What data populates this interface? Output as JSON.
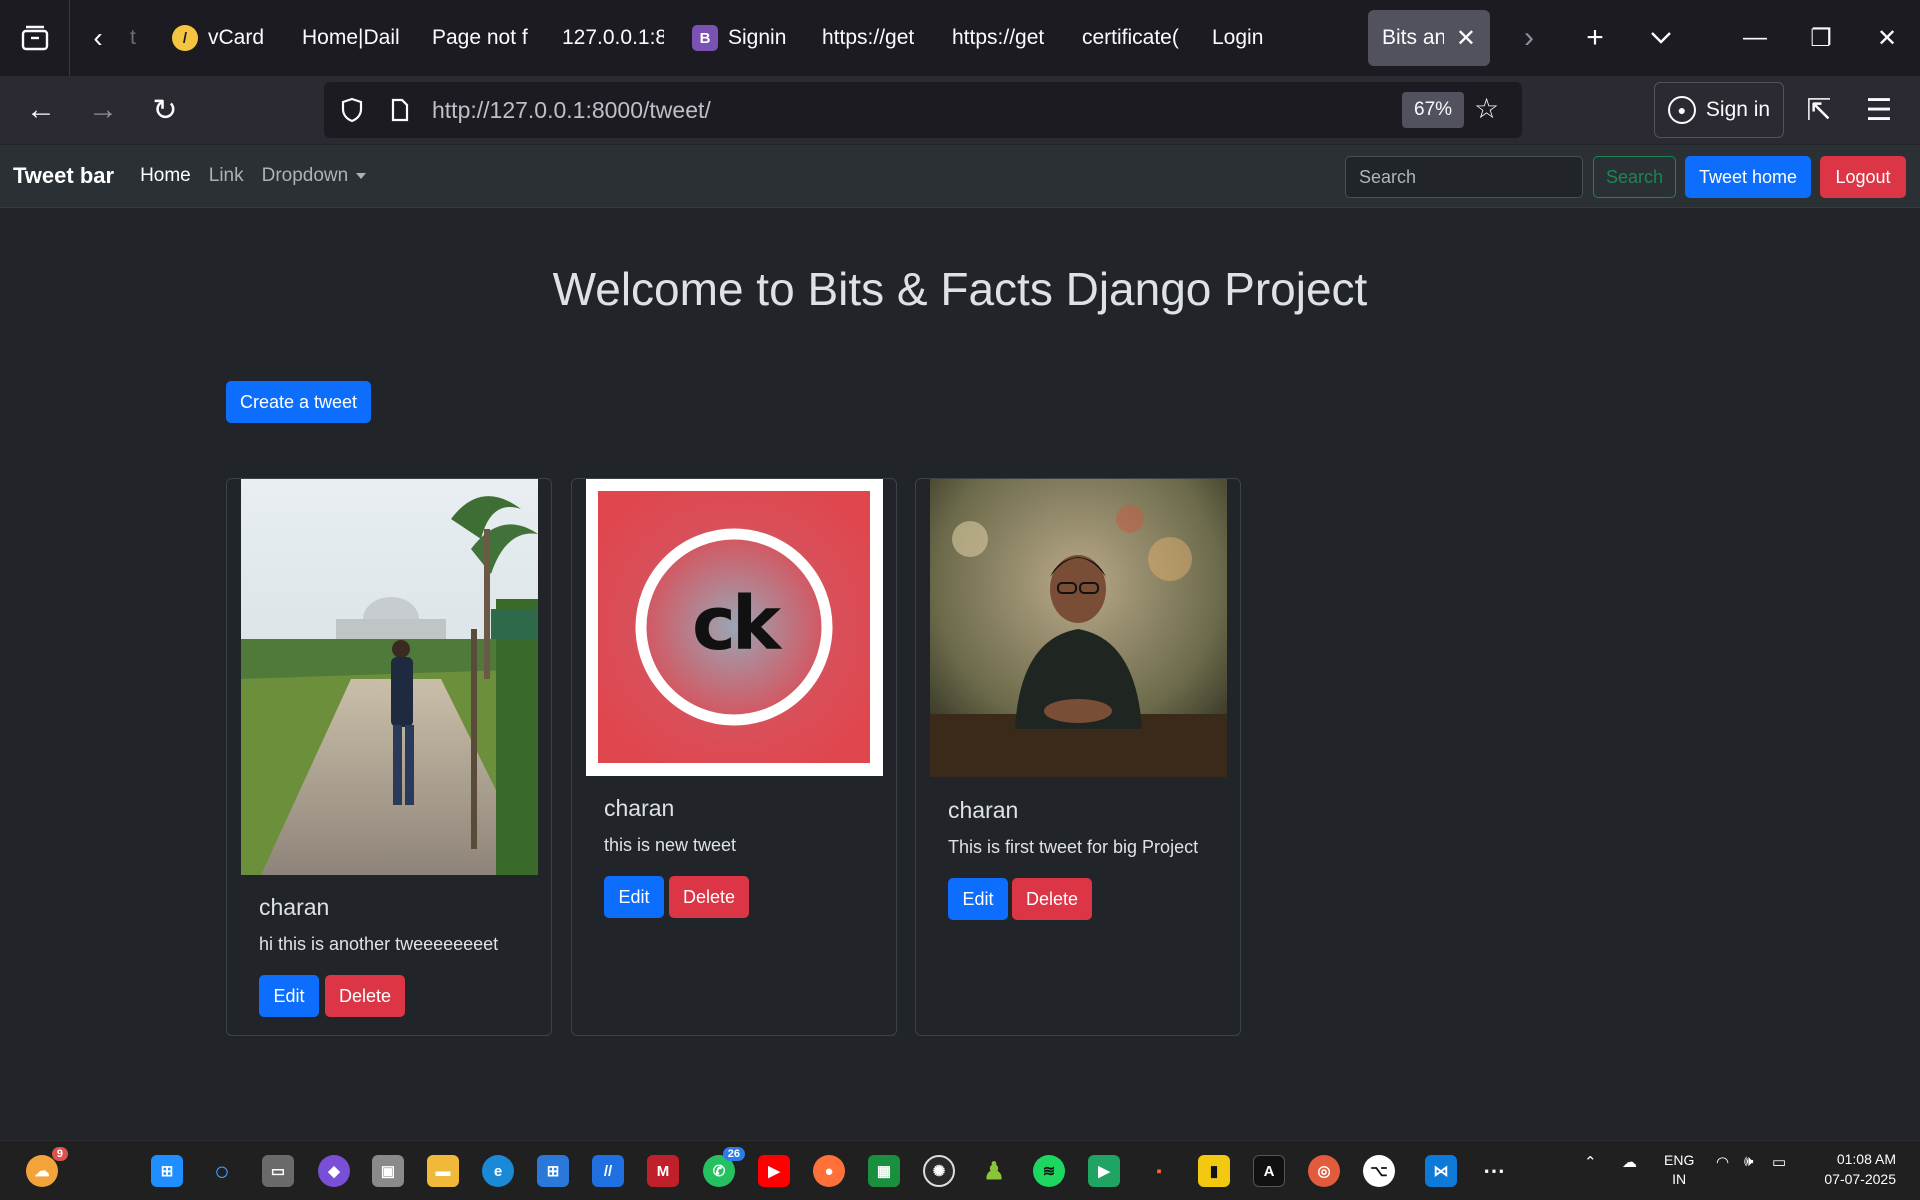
{
  "browser": {
    "tabs": [
      {
        "label": "t",
        "icon": "generic"
      },
      {
        "label": "vCard",
        "icon": "vcard-icon"
      },
      {
        "label": "Home|Dail",
        "icon": ""
      },
      {
        "label": "Page not f",
        "icon": ""
      },
      {
        "label": "127.0.0.1:8",
        "icon": ""
      },
      {
        "label": "Signin",
        "icon": "bootstrap-icon"
      },
      {
        "label": "https://get",
        "icon": ""
      },
      {
        "label": "https://get",
        "icon": ""
      },
      {
        "label": "certificate(",
        "icon": ""
      },
      {
        "label": "Login",
        "icon": ""
      }
    ],
    "active_tab": {
      "label": "Bits and",
      "close": "✕"
    },
    "url": "http://127.0.0.1:8000/tweet/",
    "zoom": "67%",
    "sign_in": "Sign in"
  },
  "app": {
    "brand": "Tweet bar",
    "nav": {
      "home": "Home",
      "link": "Link",
      "dropdown": "Dropdown"
    },
    "search_placeholder": "Search",
    "search_button": "Search",
    "tweet_home": "Tweet home",
    "logout": "Logout",
    "welcome": "Welcome to Bits & Facts Django Project",
    "create_tweet": "Create a tweet"
  },
  "tweets": [
    {
      "author": "charan",
      "text": "hi this is another tweeeeeeeet",
      "edit": "Edit",
      "delete": "Delete",
      "image": "person-at-memorial-photo"
    },
    {
      "author": "charan",
      "text": "this is new tweet",
      "edit": "Edit",
      "delete": "Delete",
      "image": "ck-logo",
      "logo_text": "ck"
    },
    {
      "author": "charan",
      "text": "This is first tweet for big Project",
      "edit": "Edit",
      "delete": "Delete",
      "image": "person-at-table-photo"
    }
  ],
  "taskbar": {
    "weather_badge": "9",
    "whatsapp_badge": "26",
    "lang_top": "ENG",
    "lang_bottom": "IN",
    "time": "01:08 AM",
    "date": "07-07-2025"
  },
  "colors": {
    "primary": "#0d6efd",
    "danger": "#dc3545",
    "success": "#198754",
    "page_bg": "#212529",
    "navbar_bg": "#2b3035"
  }
}
